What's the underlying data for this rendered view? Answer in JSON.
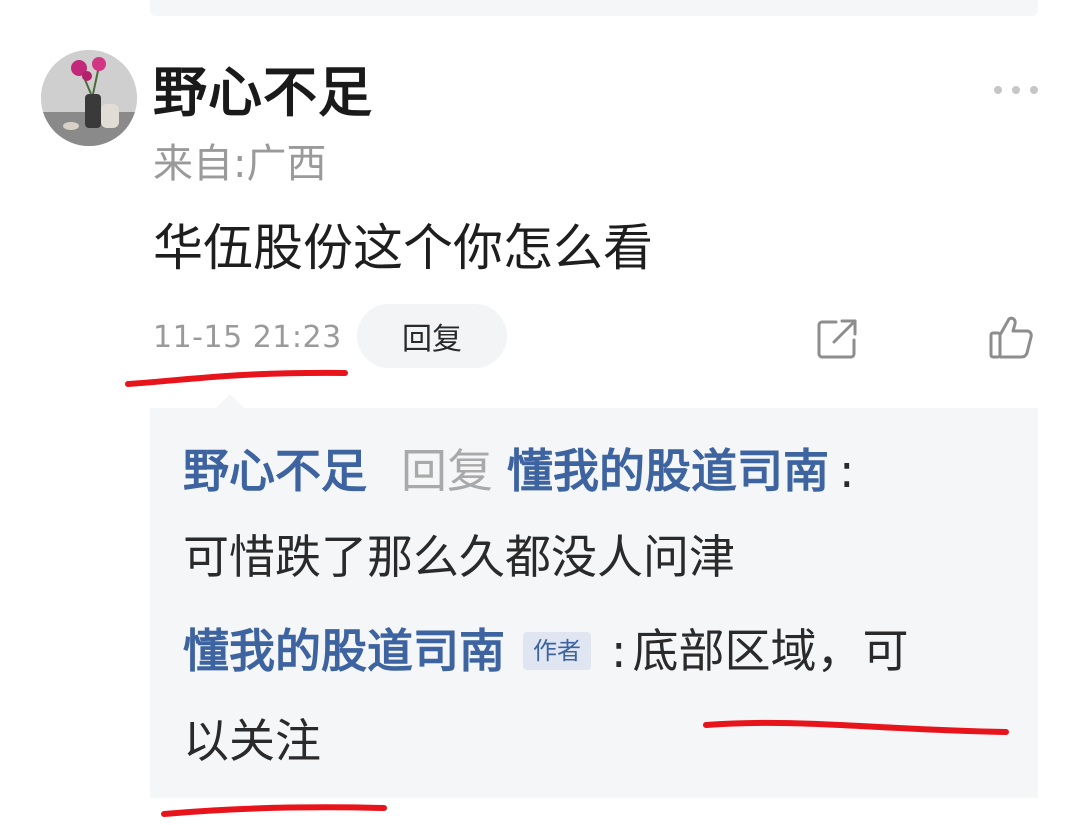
{
  "comment": {
    "username": "野心不足",
    "location": "来自:广西",
    "text": "华伍股份这个你怎么看",
    "timestamp": "11-15 21:23",
    "reply_label": "回复"
  },
  "icons": {
    "more": "more-dots-icon",
    "share": "share-icon",
    "like": "thumbs-up-icon"
  },
  "replies": [
    {
      "author": "野心不足",
      "reply_word": "回复",
      "target": "懂我的股道司南",
      "colon": ":",
      "text": "可惜跌了那么久都没人问津"
    },
    {
      "author": "懂我的股道司南",
      "author_tag": "作者",
      "colon": ":",
      "text_line1": "底部区域，可",
      "text_line2": "以关注"
    }
  ],
  "colors": {
    "name_blue": "#3d64a0",
    "annotation_red": "#e8141c",
    "muted_gray": "#9a9a9a",
    "reply_bg": "#f5f6f8"
  }
}
